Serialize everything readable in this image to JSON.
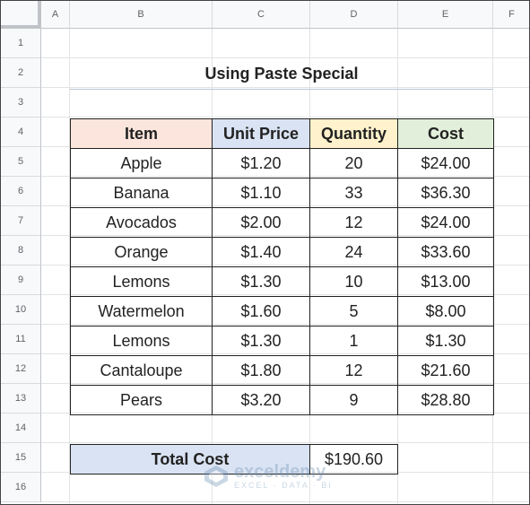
{
  "sheet": {
    "columns": [
      "A",
      "B",
      "C",
      "D",
      "E",
      "F"
    ],
    "rows": [
      "1",
      "2",
      "3",
      "4",
      "5",
      "6",
      "7",
      "8",
      "9",
      "10",
      "11",
      "12",
      "13",
      "14",
      "15",
      "16"
    ]
  },
  "title": "Using Paste Special",
  "table": {
    "headers": [
      "Item",
      "Unit Price",
      "Quantity",
      "Cost"
    ],
    "header_colors": [
      "#fce5dc",
      "#dae3f3",
      "#fff2cc",
      "#e2efda"
    ],
    "rows": [
      [
        "Apple",
        "$1.20",
        "20",
        "$24.00"
      ],
      [
        "Banana",
        "$1.10",
        "33",
        "$36.30"
      ],
      [
        "Avocados",
        "$2.00",
        "12",
        "$24.00"
      ],
      [
        "Orange",
        "$1.40",
        "24",
        "$33.60"
      ],
      [
        "Lemons",
        "$1.30",
        "10",
        "$13.00"
      ],
      [
        "Watermelon",
        "$1.60",
        "5",
        "$8.00"
      ],
      [
        "Lemons",
        "$1.30",
        "1",
        "$1.30"
      ],
      [
        "Cantaloupe",
        "$1.80",
        "12",
        "$21.60"
      ],
      [
        "Pears",
        "$3.20",
        "9",
        "$28.80"
      ]
    ]
  },
  "total": {
    "label": "Total Cost",
    "value": "$190.60",
    "label_color": "#dae3f3"
  },
  "watermark": {
    "name": "exceldemy",
    "tagline": "EXCEL · DATA · BI",
    "icon": "exceldemy-logo-icon"
  }
}
